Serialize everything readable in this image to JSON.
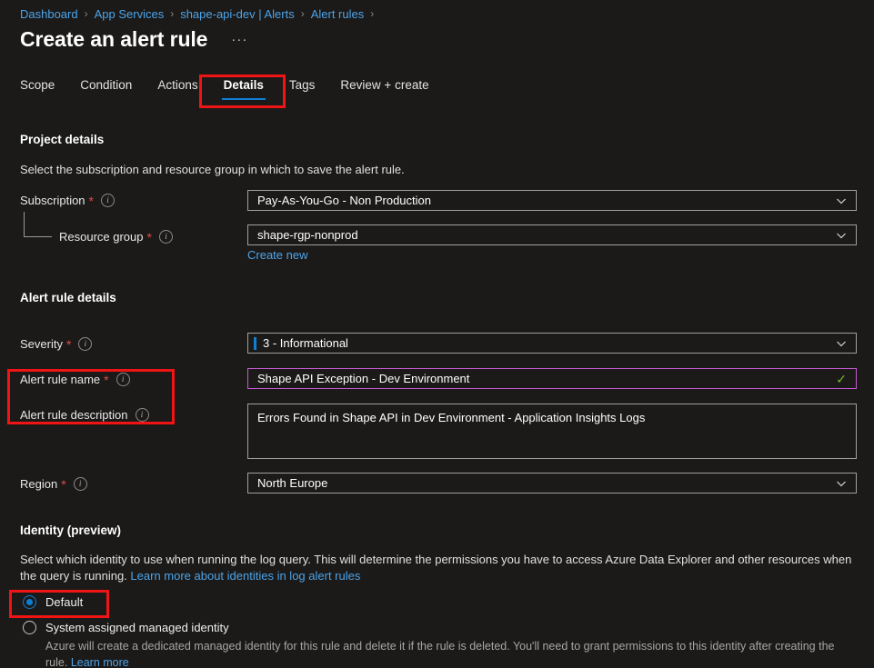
{
  "breadcrumb": {
    "items": [
      {
        "label": "Dashboard"
      },
      {
        "label": "App Services"
      },
      {
        "label": "shape-api-dev | Alerts"
      },
      {
        "label": "Alert rules"
      }
    ],
    "separator": "›"
  },
  "header": {
    "title": "Create an alert rule",
    "more_label": "···"
  },
  "tabs": [
    {
      "label": "Scope",
      "active": false
    },
    {
      "label": "Condition",
      "active": false
    },
    {
      "label": "Actions",
      "active": false
    },
    {
      "label": "Details",
      "active": true
    },
    {
      "label": "Tags",
      "active": false
    },
    {
      "label": "Review + create",
      "active": false
    }
  ],
  "project_details": {
    "title": "Project details",
    "description": "Select the subscription and resource group in which to save the alert rule.",
    "subscription": {
      "label": "Subscription",
      "required": "*",
      "value": "Pay-As-You-Go - Non Production"
    },
    "resource_group": {
      "label": "Resource group",
      "required": "*",
      "value": "shape-rgp-nonprod",
      "create_new_label": "Create new"
    }
  },
  "alert_rule_details": {
    "title": "Alert rule details",
    "severity": {
      "label": "Severity",
      "required": "*",
      "value": "3 - Informational",
      "indicator_color": "#0f7fd4"
    },
    "rule_name": {
      "label": "Alert rule name",
      "required": "*",
      "value": "Shape API Exception - Dev Environment",
      "valid_mark": "✓"
    },
    "rule_description": {
      "label": "Alert rule description",
      "value": "Errors Found in Shape API in Dev Environment - Application Insights Logs"
    },
    "region": {
      "label": "Region",
      "required": "*",
      "value": "North Europe"
    }
  },
  "identity": {
    "title": "Identity (preview)",
    "description_part1": "Select which identity to use when running the log query. This will determine the permissions you have to access Azure Data Explorer and other resources when the query is running.",
    "description_link": "Learn more about identities in log alert rules",
    "options": [
      {
        "label": "Default",
        "selected": true,
        "description": "",
        "link": ""
      },
      {
        "label": "System assigned managed identity",
        "selected": false,
        "description": "Azure will create a dedicated managed identity for this rule and delete it if the rule is deleted. You'll need to grant permissions to this identity after creating the rule.",
        "link": "Learn more"
      }
    ]
  },
  "colors": {
    "background": "#1b1a19",
    "accent_blue": "#0f7fd4",
    "link_blue": "#4da3e8",
    "required_red": "#e04a4a",
    "annotation_red": "#f01414",
    "focus_purple": "#c45ad0",
    "valid_green": "#74b72e"
  }
}
